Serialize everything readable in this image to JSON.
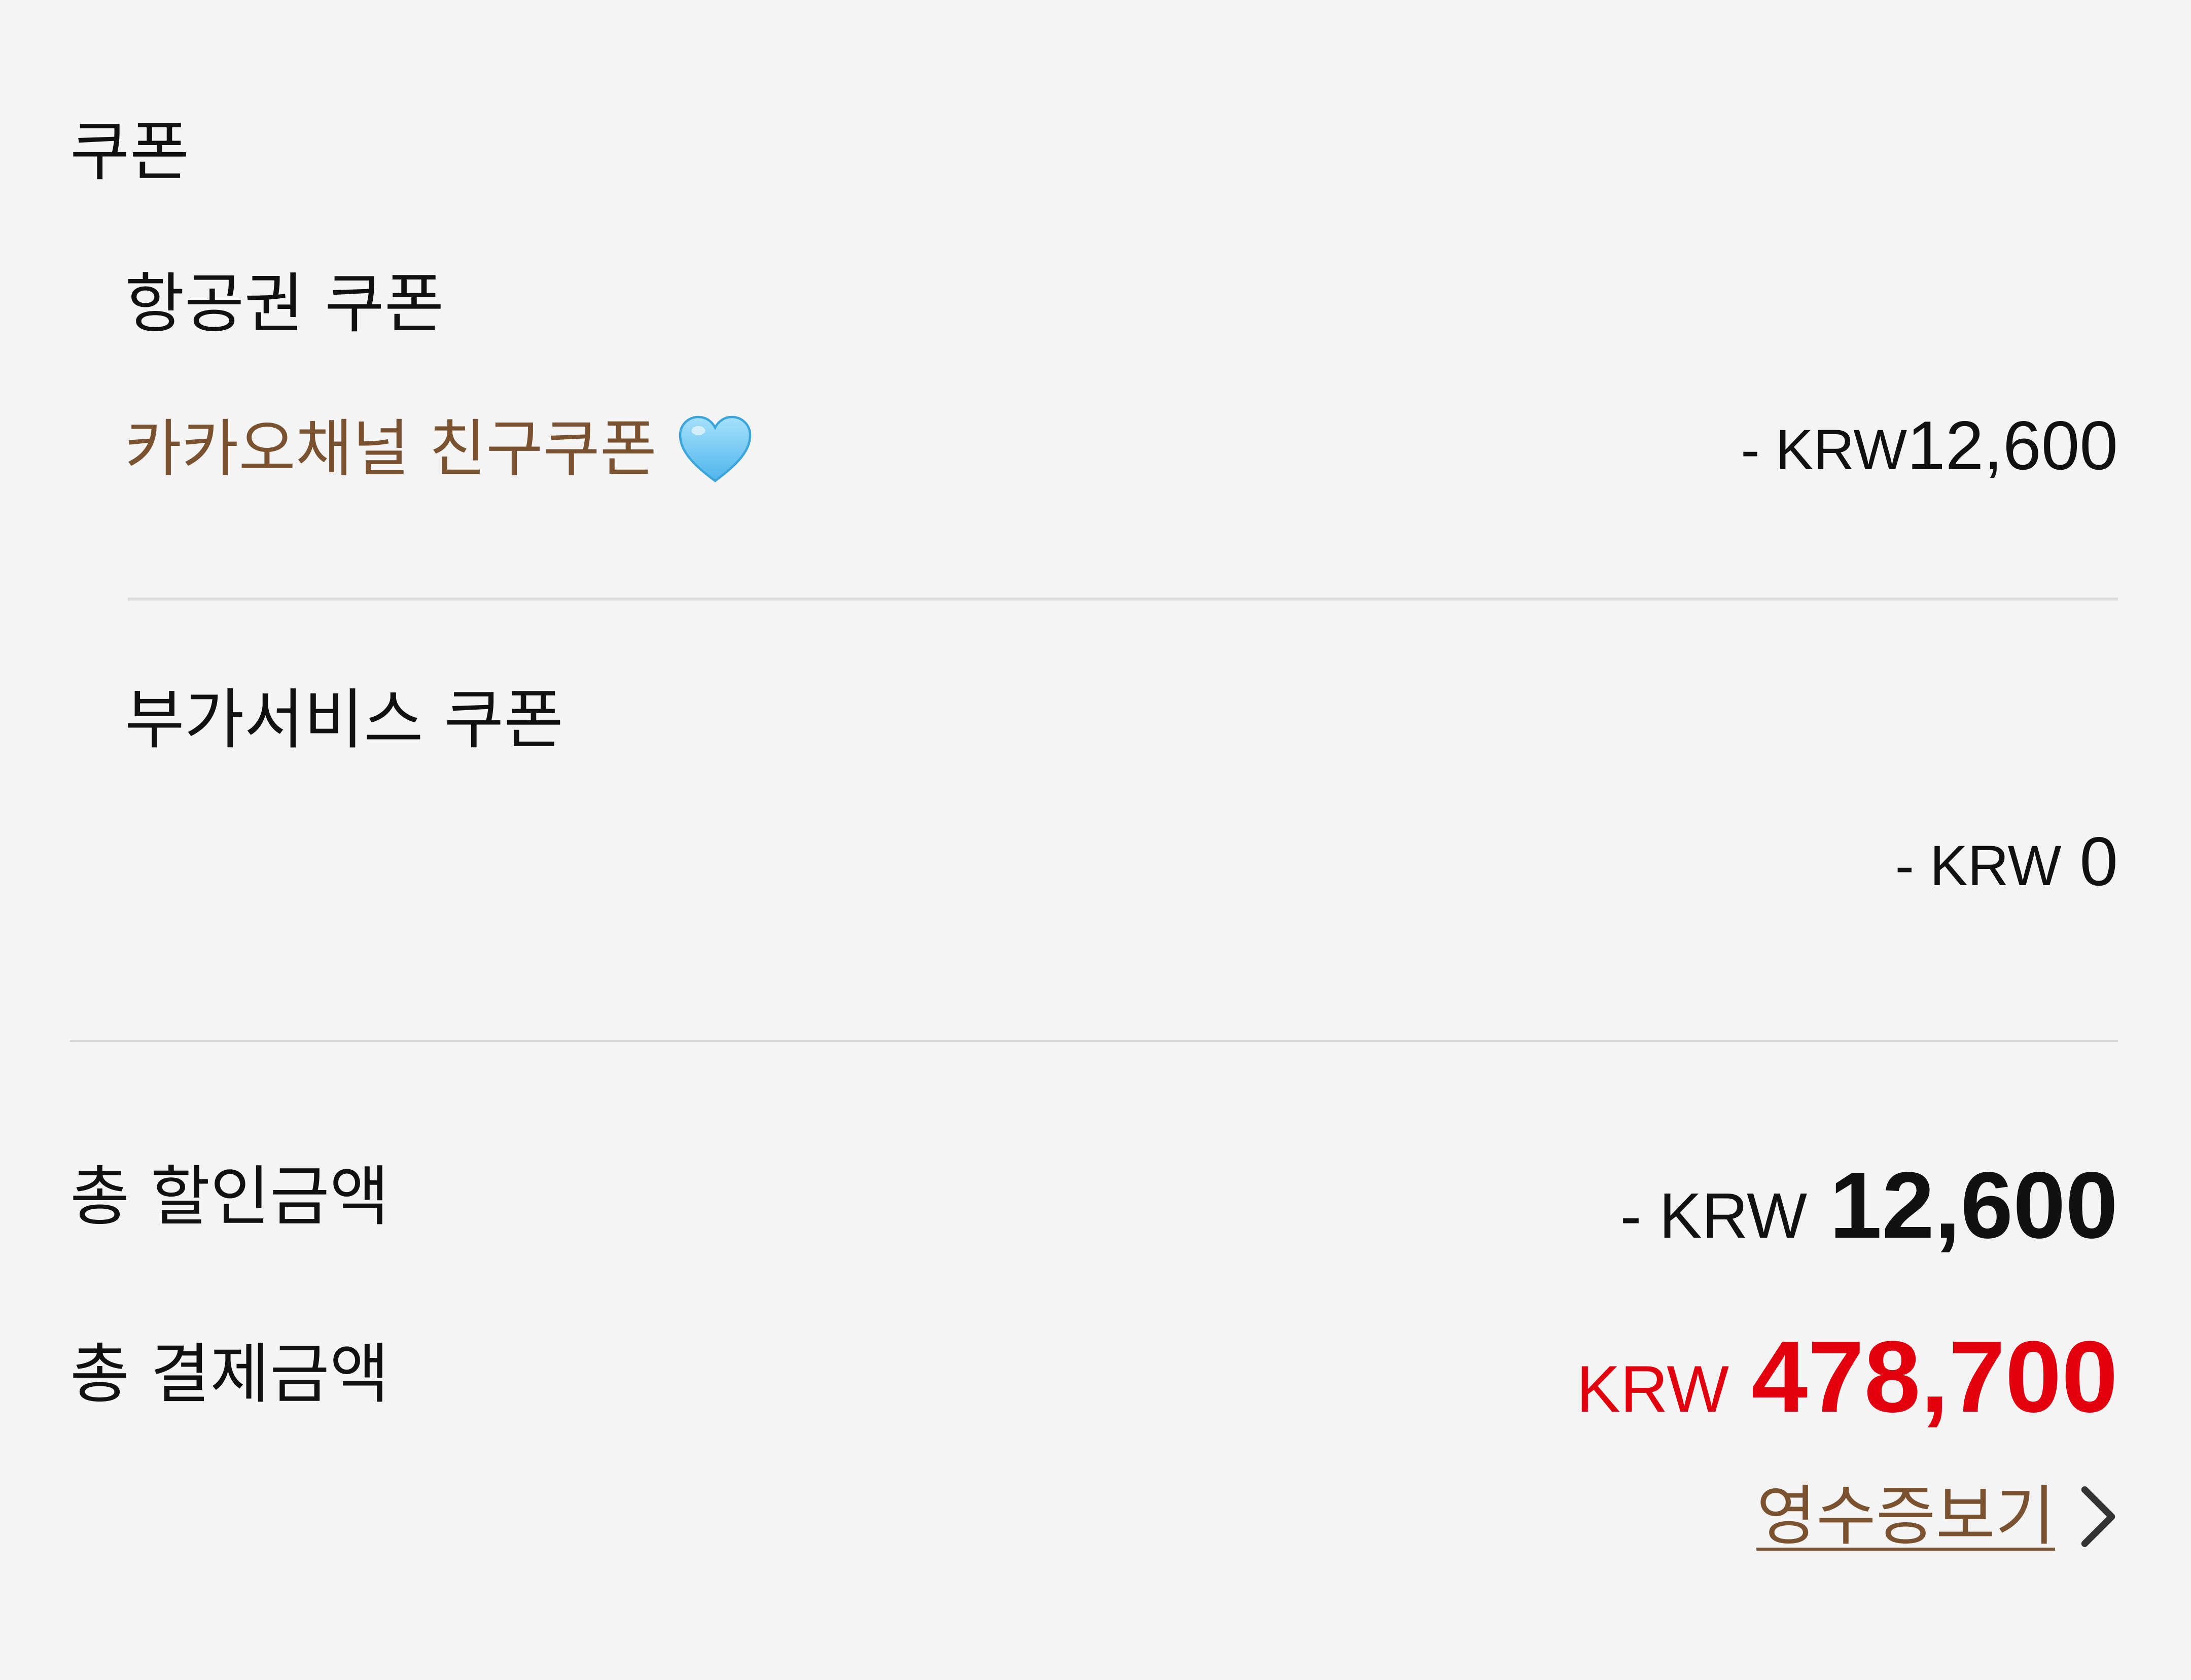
{
  "coupon_section": {
    "title": "쿠폰",
    "airline": {
      "title": "항공권 쿠폰",
      "coupon_name": "카카오채널 친구쿠폰",
      "coupon_icon": "blue-heart-icon",
      "amount_prefix": "- KRW",
      "amount_value": "12,600"
    },
    "service": {
      "title": "부가서비스 쿠폰",
      "amount_prefix": "- KRW",
      "amount_value": "0"
    }
  },
  "totals": {
    "discount": {
      "label": "총 할인금액",
      "amount_prefix": "- KRW",
      "amount_value": "12,600"
    },
    "payment": {
      "label": "총 결제금액",
      "amount_prefix": "KRW",
      "amount_value": "478,700",
      "color": "#e2000f"
    }
  },
  "receipt": {
    "label": "영수증보기",
    "icon": "chevron-right-icon"
  },
  "colors": {
    "background": "#f4f4f4",
    "accent_brown": "#7a5230",
    "heart_blue": "#6cc6f0",
    "total_red": "#e2000f"
  }
}
